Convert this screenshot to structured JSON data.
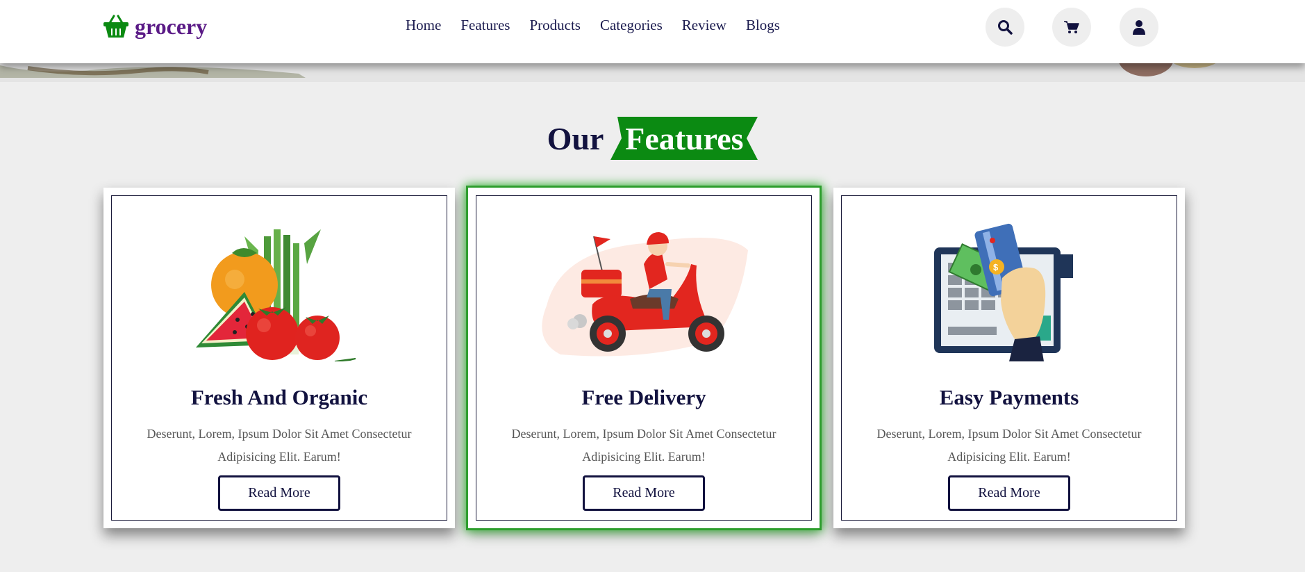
{
  "header": {
    "logo_text": "grocery",
    "nav": [
      "Home",
      "Features",
      "Products",
      "Categories",
      "Review",
      "Blogs"
    ],
    "icons": [
      "search-icon",
      "cart-icon",
      "user-icon"
    ]
  },
  "section": {
    "title_plain": "Our",
    "title_highlight": "Features"
  },
  "cards": [
    {
      "image": "vegetables-illustration",
      "title": "Fresh And Organic",
      "text": "Deserunt, Lorem, Ipsum Dolor Sit Amet Consectetur Adipisicing Elit. Earum!",
      "button": "Read More"
    },
    {
      "image": "delivery-scooter-illustration",
      "title": "Free Delivery",
      "text": "Deserunt, Lorem, Ipsum Dolor Sit Amet Consectetur Adipisicing Elit. Earum!",
      "button": "Read More"
    },
    {
      "image": "card-payment-illustration",
      "title": "Easy Payments",
      "text": "Deserunt, Lorem, Ipsum Dolor Sit Amet Consectetur Adipisicing Elit. Earum!",
      "button": "Read More"
    }
  ],
  "colors": {
    "brand_green": "#0b8a12",
    "brand_purple": "#5a1a86",
    "text_dark": "#12123f",
    "background": "#eeeeee"
  }
}
